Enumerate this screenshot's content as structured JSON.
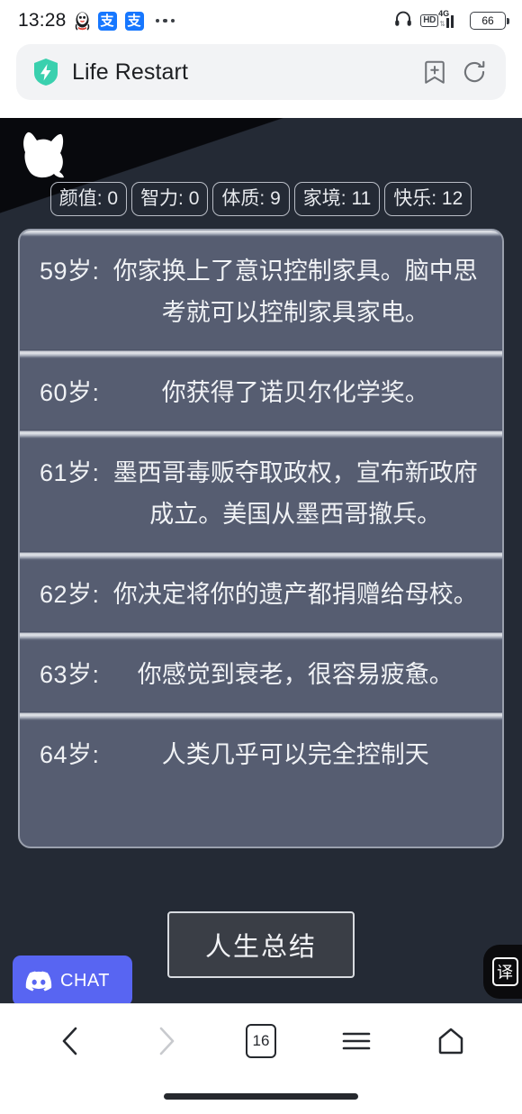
{
  "status_bar": {
    "time": "13:28",
    "icons_left": [
      "qq-icon",
      "alipay-icon",
      "alipay-icon",
      "more-dots-icon"
    ],
    "alipay_glyph": "支",
    "network_type": "4G",
    "hd_label": "HD",
    "battery_percent": "66",
    "icons_right": [
      "headphone-icon",
      "hd-icon",
      "signal-icon",
      "battery-icon"
    ]
  },
  "browser": {
    "site_title": "Life Restart",
    "logo": "shield-bolt-icon",
    "logo_color": "#3ad0ae",
    "actions": [
      {
        "name": "bookmark-add-icon"
      },
      {
        "name": "refresh-icon"
      }
    ]
  },
  "game": {
    "background_color": "#242a35",
    "panel_color": "#565d71",
    "avatar_icon": "cat-silhouette-icon",
    "stats": [
      {
        "label": "颜值",
        "value": "0",
        "text": "颜值: 0"
      },
      {
        "label": "智力",
        "value": "0",
        "text": "智力: 0"
      },
      {
        "label": "体质",
        "value": "9",
        "text": "体质: 9"
      },
      {
        "label": "家境",
        "value": "11",
        "text": "家境: 11"
      },
      {
        "label": "快乐",
        "value": "12",
        "text": "快乐: 12"
      }
    ],
    "events": [
      {
        "age": "59岁:",
        "text": "你家换上了意识控制家具。脑中思考就可以控制家具家电。"
      },
      {
        "age": "60岁:",
        "text": "你获得了诺贝尔化学奖。"
      },
      {
        "age": "61岁:",
        "text": "墨西哥毒贩夺取政权，宣布新政府成立。美国从墨西哥撤兵。"
      },
      {
        "age": "62岁:",
        "text": "你决定将你的遗产都捐赠给母校。"
      },
      {
        "age": "63岁:",
        "text": "你感觉到衰老，很容易疲惫。"
      },
      {
        "age": "64岁:",
        "text": "人类几乎可以完全控制天"
      }
    ],
    "summary_button": "人生总结",
    "discord_button": "CHAT",
    "translate_button": "译"
  },
  "bottom_nav": {
    "back": "back-arrow-icon",
    "forward": "forward-arrow-icon",
    "tab_count": "16",
    "menu": "hamburger-menu-icon",
    "home": "home-icon"
  }
}
